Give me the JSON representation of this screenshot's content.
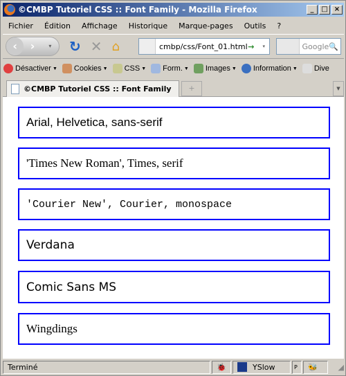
{
  "window": {
    "title": "©CMBP Tutoriel CSS :: Font Family - Mozilla Firefox",
    "controls": [
      "_",
      "□",
      "×"
    ]
  },
  "menu": [
    "Fichier",
    "Édition",
    "Affichage",
    "Historique",
    "Marque-pages",
    "Outils",
    "?"
  ],
  "nav": {
    "url": "cmbp/css/Font_01.html",
    "search_placeholder": "Google"
  },
  "webdev_toolbar": [
    "Désactiver",
    "Cookies",
    "CSS",
    "Form.",
    "Images",
    "Information",
    "Dive"
  ],
  "tab": {
    "title": "©CMBP Tutoriel CSS :: Font Family",
    "new_tab": "+"
  },
  "boxes": [
    "Arial, Helvetica, sans-serif",
    "'Times New Roman', Times, serif",
    "'Courier New', Courier, monospace",
    "Verdana",
    "Comic Sans MS",
    "Wingdings"
  ],
  "status": {
    "text": "Terminé",
    "yslow": "YSlow",
    "p": "P"
  },
  "colors": {
    "box_border": "#0000ff",
    "title_gradient_start": "#0a246a"
  }
}
